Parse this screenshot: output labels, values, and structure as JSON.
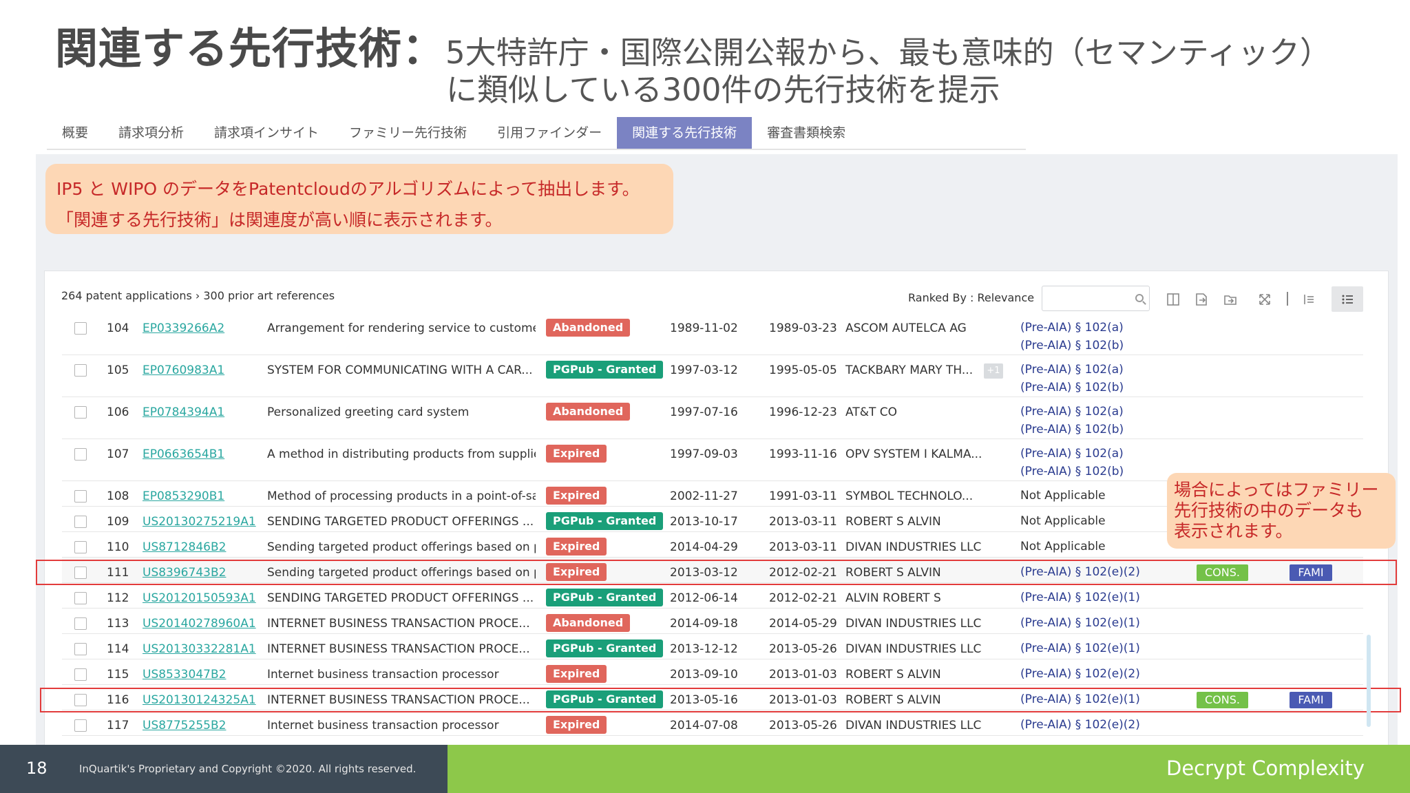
{
  "headline": {
    "main": "関連する先行技術：",
    "sub_line1": "5大特許庁・国際公開公報から、最も意味的（セマンティック）",
    "sub_line2": "に類似している300件の先行技術を提示"
  },
  "tabs": [
    {
      "label": "概要",
      "active": false
    },
    {
      "label": "請求項分析",
      "active": false
    },
    {
      "label": "請求項インサイト",
      "active": false
    },
    {
      "label": "ファミリー先行技術",
      "active": false
    },
    {
      "label": "引用ファインダー",
      "active": false
    },
    {
      "label": "関連する先行技術",
      "active": true
    },
    {
      "label": "審査書類検索",
      "active": false
    }
  ],
  "note1": {
    "line1": "IP5 と WIPO のデータをPatentcloudのアルゴリズムによって抽出します。",
    "line2": "「関連する先行技術」は関連度が高い順に表示されます。"
  },
  "summary": "264 patent applications › 300 prior art references",
  "ranked_by": "Ranked By : Relevance",
  "search": {
    "placeholder": ""
  },
  "rows": [
    {
      "num": "104",
      "id": "EP0339266A2",
      "title": "Arrangement for rendering service to customers...",
      "status": "Abandoned",
      "status_type": "abandoned",
      "date1": "1989-11-02",
      "date2": "1989-03-23",
      "assignee": "ASCOM AUTELCA AG",
      "plus": "",
      "law1": "(Pre-AIA) § 102(a)",
      "law2": "(Pre-AIA) § 102(b)",
      "cons": "",
      "fami": ""
    },
    {
      "num": "105",
      "id": "EP0760983A1",
      "title": "SYSTEM FOR COMMUNICATING WITH A CAR...",
      "status": "PGPub - Granted",
      "status_type": "granted",
      "date1": "1997-03-12",
      "date2": "1995-05-05",
      "assignee": "TACKBARY MARY TH...",
      "plus": "+1",
      "law1": "(Pre-AIA) § 102(a)",
      "law2": "(Pre-AIA) § 102(b)",
      "cons": "",
      "fami": ""
    },
    {
      "num": "106",
      "id": "EP0784394A1",
      "title": "Personalized greeting card system",
      "status": "Abandoned",
      "status_type": "abandoned",
      "date1": "1997-07-16",
      "date2": "1996-12-23",
      "assignee": "AT&T CO",
      "plus": "",
      "law1": "(Pre-AIA) § 102(a)",
      "law2": "(Pre-AIA) § 102(b)",
      "cons": "",
      "fami": ""
    },
    {
      "num": "107",
      "id": "EP0663654B1",
      "title": "A method in distributing products from supplier...",
      "status": "Expired",
      "status_type": "expired",
      "date1": "1997-09-03",
      "date2": "1993-11-16",
      "assignee": "OPV SYSTEM I KALMA...",
      "plus": "",
      "law1": "(Pre-AIA) § 102(a)",
      "law2": "(Pre-AIA) § 102(b)",
      "cons": "",
      "fami": ""
    },
    {
      "num": "108",
      "id": "EP0853290B1",
      "title": "Method of processing products in a point-of-sal...",
      "status": "Expired",
      "status_type": "expired",
      "date1": "2002-11-27",
      "date2": "1991-03-11",
      "assignee": "SYMBOL TECHNOLO...",
      "plus": "",
      "law1": "Not Applicable",
      "law2": "",
      "cons": "",
      "fami": ""
    },
    {
      "num": "109",
      "id": "US20130275219A1",
      "title": "SENDING TARGETED PRODUCT OFFERINGS ...",
      "status": "PGPub - Granted",
      "status_type": "granted",
      "date1": "2013-10-17",
      "date2": "2013-03-11",
      "assignee": "ROBERT S ALVIN",
      "plus": "",
      "law1": "Not Applicable",
      "law2": "",
      "cons": "",
      "fami": ""
    },
    {
      "num": "110",
      "id": "US8712846B2",
      "title": "Sending targeted product offerings based on pe...",
      "status": "Expired",
      "status_type": "expired",
      "date1": "2014-04-29",
      "date2": "2013-03-11",
      "assignee": "DIVAN INDUSTRIES LLC",
      "plus": "",
      "law1": "Not Applicable",
      "law2": "",
      "cons": "",
      "fami": ""
    },
    {
      "num": "111",
      "id": "US8396743B2",
      "title": "Sending targeted product offerings based on pe...",
      "status": "Expired",
      "status_type": "expired",
      "date1": "2013-03-12",
      "date2": "2012-02-21",
      "assignee": "ROBERT S ALVIN",
      "plus": "",
      "law1": "(Pre-AIA) § 102(e)(2)",
      "law2": "",
      "cons": "CONS.",
      "fami": "FAMI"
    },
    {
      "num": "112",
      "id": "US20120150593A1",
      "title": "SENDING TARGETED PRODUCT OFFERINGS ...",
      "status": "PGPub - Granted",
      "status_type": "granted",
      "date1": "2012-06-14",
      "date2": "2012-02-21",
      "assignee": "ALVIN ROBERT S",
      "plus": "",
      "law1": "(Pre-AIA) § 102(e)(1)",
      "law2": "",
      "cons": "",
      "fami": ""
    },
    {
      "num": "113",
      "id": "US20140278960A1",
      "title": "INTERNET BUSINESS TRANSACTION PROCE...",
      "status": "Abandoned",
      "status_type": "abandoned",
      "date1": "2014-09-18",
      "date2": "2014-05-29",
      "assignee": "DIVAN INDUSTRIES LLC",
      "plus": "",
      "law1": "(Pre-AIA) § 102(e)(1)",
      "law2": "",
      "cons": "",
      "fami": ""
    },
    {
      "num": "114",
      "id": "US20130332281A1",
      "title": "INTERNET BUSINESS TRANSACTION PROCE...",
      "status": "PGPub - Granted",
      "status_type": "granted",
      "date1": "2013-12-12",
      "date2": "2013-05-26",
      "assignee": "DIVAN INDUSTRIES LLC",
      "plus": "",
      "law1": "(Pre-AIA) § 102(e)(1)",
      "law2": "",
      "cons": "",
      "fami": ""
    },
    {
      "num": "115",
      "id": "US8533047B2",
      "title": "Internet business transaction processor",
      "status": "Expired",
      "status_type": "expired",
      "date1": "2013-09-10",
      "date2": "2013-01-03",
      "assignee": "ROBERT S ALVIN",
      "plus": "",
      "law1": "(Pre-AIA) § 102(e)(2)",
      "law2": "",
      "cons": "",
      "fami": ""
    },
    {
      "num": "116",
      "id": "US20130124325A1",
      "title": "INTERNET BUSINESS TRANSACTION PROCE...",
      "status": "PGPub - Granted",
      "status_type": "granted",
      "date1": "2013-05-16",
      "date2": "2013-01-03",
      "assignee": "ROBERT S ALVIN",
      "plus": "",
      "law1": "(Pre-AIA) § 102(e)(1)",
      "law2": "",
      "cons": "CONS.",
      "fami": "FAMI"
    },
    {
      "num": "117",
      "id": "US8775255B2",
      "title": "Internet business transaction processor",
      "status": "Expired",
      "status_type": "expired",
      "date1": "2014-07-08",
      "date2": "2013-05-26",
      "assignee": "DIVAN INDUSTRIES LLC",
      "plus": "",
      "law1": "(Pre-AIA) § 102(e)(2)",
      "law2": "",
      "cons": "",
      "fami": ""
    }
  ],
  "note2": {
    "line1": "場合によってはファミリー",
    "line2": "先行技術の中のデータも",
    "line3": "表示されます。"
  },
  "footer": {
    "page_number": "18",
    "copyright": "InQuartik's Proprietary and Copyright ©2020. All rights reserved.",
    "tagline": "Decrypt Complexity"
  },
  "colors": {
    "accent_tab": "#7b83c3",
    "granted": "#1a9f79",
    "expired_abandoned": "#e0665c",
    "cons": "#74c148",
    "fami": "#4a5ab3",
    "footer_dark": "#3d4a56",
    "footer_green": "#8dc84a"
  }
}
